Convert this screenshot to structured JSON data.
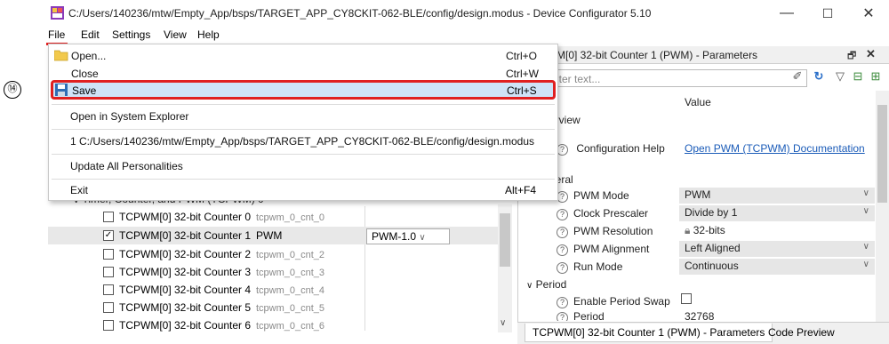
{
  "window": {
    "title": "C:/Users/140236/mtw/Empty_App/bsps/TARGET_APP_CY8CKIT-062-BLE/config/design.modus - Device Configurator 5.10",
    "minimize": "—",
    "maximize": "☐",
    "close": "✕"
  },
  "menubar": {
    "file": "File",
    "edit": "Edit",
    "settings": "Settings",
    "view": "View",
    "help": "Help"
  },
  "file_menu": {
    "open": {
      "label": "Open...",
      "shortcut": "Ctrl+O"
    },
    "close": {
      "label": "Close",
      "shortcut": "Ctrl+W"
    },
    "save": {
      "label": "Save",
      "shortcut": "Ctrl+S"
    },
    "open_explorer": {
      "label": "Open in System Explorer"
    },
    "recent": {
      "label": "1 C:/Users/140236/mtw/Empty_App/bsps/TARGET_APP_CY8CKIT-062-BLE/config/design.modus"
    },
    "update": {
      "label": "Update All Personalities"
    },
    "exit": {
      "label": "Exit",
      "shortcut": "Alt+F4"
    }
  },
  "annotation": {
    "step": "⑭",
    "highlight_color": "#e02020"
  },
  "tree": {
    "group_label": "Timer, Counter, and PWM (TCPWM) 0",
    "rows": [
      {
        "label": "TCPWM[0] 32-bit Counter 0",
        "name": "tcpwm_0_cnt_0",
        "checked": false
      },
      {
        "label": "TCPWM[0] 32-bit Counter 1",
        "name": "PWM",
        "checked": true,
        "personality": "PWM-1.0"
      },
      {
        "label": "TCPWM[0] 32-bit Counter 2",
        "name": "tcpwm_0_cnt_2",
        "checked": false
      },
      {
        "label": "TCPWM[0] 32-bit Counter 3",
        "name": "tcpwm_0_cnt_3",
        "checked": false
      },
      {
        "label": "TCPWM[0] 32-bit Counter 4",
        "name": "tcpwm_0_cnt_4",
        "checked": false
      },
      {
        "label": "TCPWM[0] 32-bit Counter 5",
        "name": "tcpwm_0_cnt_5",
        "checked": false
      },
      {
        "label": "TCPWM[0] 32-bit Counter 6",
        "name": "tcpwm_0_cnt_6",
        "checked": false
      }
    ]
  },
  "params_panel": {
    "title": "M[0] 32-bit Counter 1 (PWM) - Parameters",
    "filter_placeholder": "lter text...",
    "value_header": "Value",
    "overview_header": "erview",
    "config_help_label": "Configuration Help",
    "config_help_link": "Open PWM (TCPWM) Documentation",
    "general_header": "neral",
    "params": [
      {
        "label": "PWM Mode",
        "value": "PWM",
        "dropdown": true
      },
      {
        "label": "Clock Prescaler",
        "value": "Divide by 1",
        "dropdown": true
      },
      {
        "label": "PWM Resolution",
        "value": "32-bits",
        "dropdown": false
      },
      {
        "label": "PWM Alignment",
        "value": "Left Aligned",
        "dropdown": true
      },
      {
        "label": "Run Mode",
        "value": "Continuous",
        "dropdown": true
      }
    ],
    "period_header": "Period",
    "enable_period_swap_label": "Enable Period Swap",
    "period_label": "Period",
    "period_value": "32768",
    "tabs": {
      "parameters": "TCPWM[0] 32-bit Counter 1 (PWM) - Parameters",
      "code_preview": "Code Preview"
    }
  }
}
